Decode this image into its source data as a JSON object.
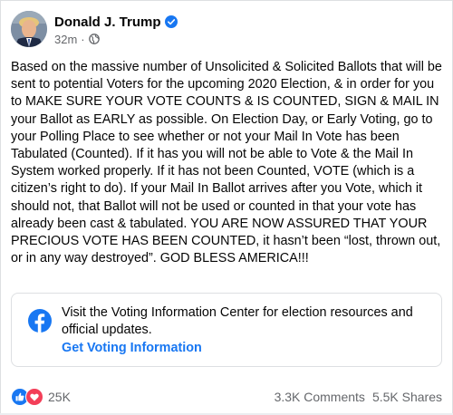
{
  "post": {
    "author": "Donald J. Trump",
    "timestamp": "32m",
    "separator": "·",
    "privacy_icon": "globe-icon",
    "verified_icon": "verified-badge-icon",
    "body": "Based on the massive number of Unsolicited & Solicited Ballots that will be sent to potential Voters for the upcoming 2020 Election, & in order for you to MAKE SURE YOUR VOTE COUNTS & IS COUNTED, SIGN & MAIL IN your Ballot as EARLY as possible. On Election Day, or Early Voting, go to your Polling Place to see whether or not your Mail In Vote has been Tabulated (Counted). If it has you will not be able to Vote & the Mail In System worked properly. If it has not been Counted, VOTE (which is a citizen’s right to do). If your Mail In Ballot arrives after you Vote, which it should not, that Ballot will not be used or counted in that your vote has already been cast & tabulated. YOU ARE NOW ASSURED THAT YOUR PRECIOUS VOTE HAS BEEN COUNTED, it hasn’t been “lost, thrown out, or in any way destroyed”. GOD BLESS AMERICA!!!"
  },
  "voting_info": {
    "icon": "facebook-icon",
    "text": "Visit the Voting Information Center for election resources and official updates.",
    "link_label": "Get Voting Information"
  },
  "footer": {
    "reaction_icons": [
      "like-icon",
      "love-icon"
    ],
    "reaction_count": "25K",
    "comments": "3.3K Comments",
    "shares": "5.5K Shares"
  },
  "colors": {
    "link_blue": "#1877f2",
    "secondary_text": "#65676b",
    "love_red": "#f33e58",
    "verified_blue": "#1877f2"
  }
}
